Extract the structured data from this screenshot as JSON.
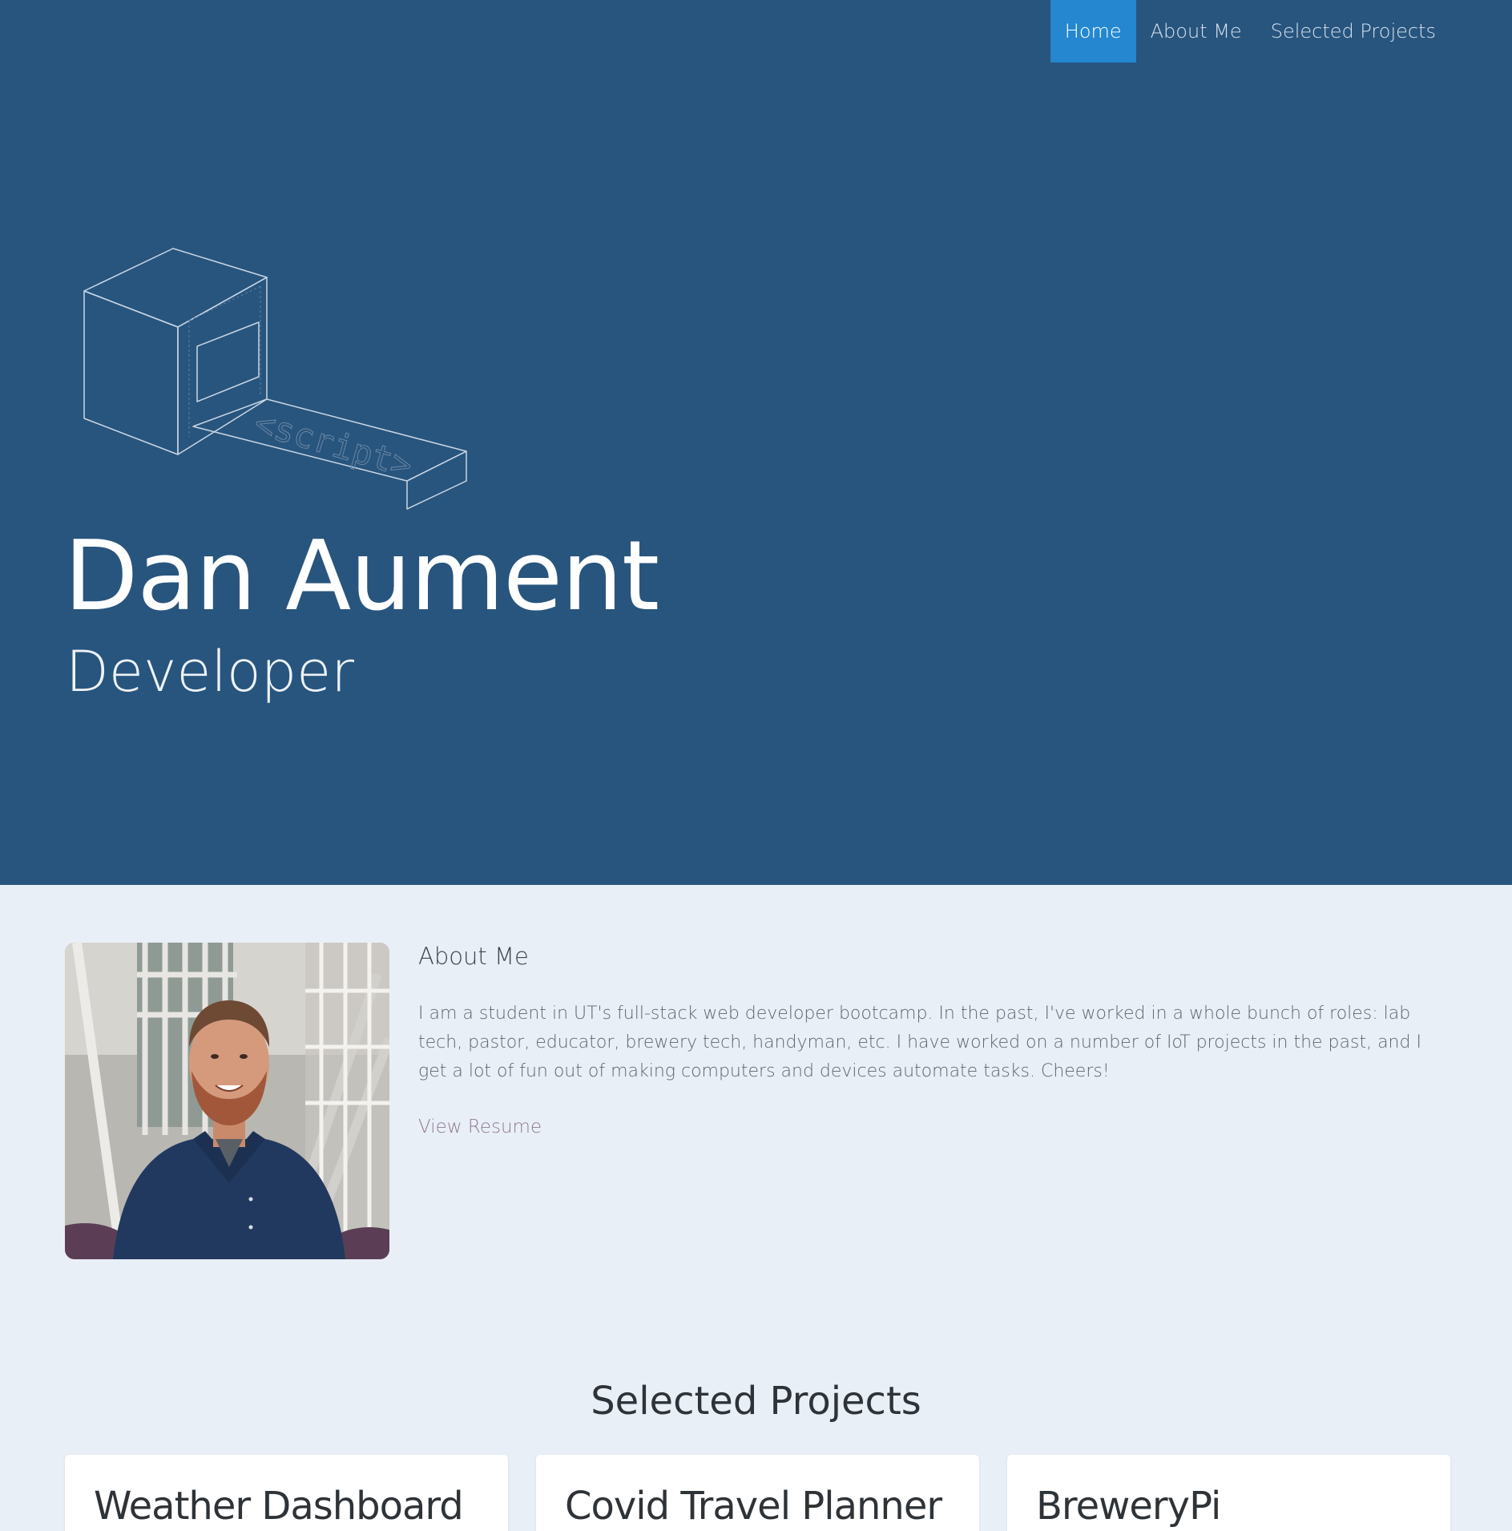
{
  "nav": {
    "items": [
      {
        "label": "Home",
        "active": true
      },
      {
        "label": "About Me",
        "active": false
      },
      {
        "label": "Selected Projects",
        "active": false
      }
    ]
  },
  "hero": {
    "logo_text": "<script>",
    "name": "Dan Aument",
    "role": "Developer"
  },
  "about": {
    "title": "About Me",
    "text": "I am a student in UT's full-stack web developer bootcamp. In the past, I've worked in a whole bunch of roles: lab tech, pastor, educator, brewery tech, handyman, etc. I have worked on a number of IoT projects in the past, and I get a lot of fun out of making computers and devices automate tasks. Cheers!",
    "resume_link": "View Resume"
  },
  "projects": {
    "title": "Selected Projects",
    "cards": [
      {
        "title": "Weather Dashboard"
      },
      {
        "title": "Covid Travel Planner"
      },
      {
        "title": "BreweryPi"
      }
    ]
  },
  "colors": {
    "hero_bg": "#28557e",
    "nav_active": "#2487d0",
    "page_bg": "#e9eff6",
    "link": "#8f7a94"
  }
}
